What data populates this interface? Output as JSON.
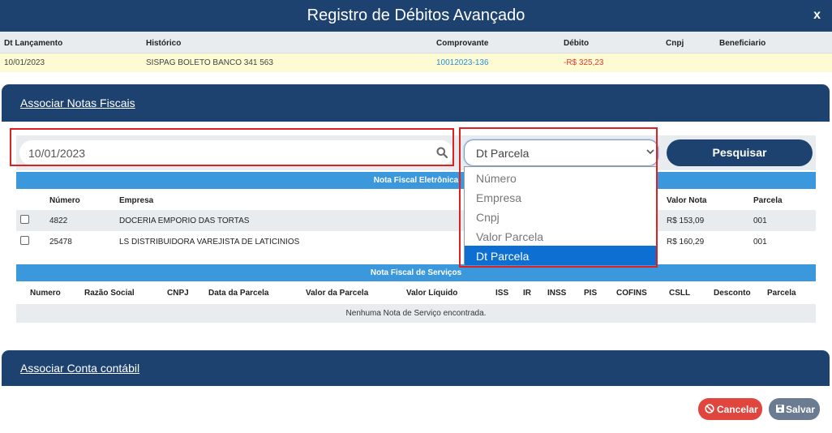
{
  "window": {
    "title": "Registro de Débitos Avançado",
    "close_label": "x"
  },
  "lancamento": {
    "headers": [
      "Dt Lançamento",
      "Histórico",
      "Comprovante",
      "Débito",
      "Cnpj",
      "Beneficiario"
    ],
    "row": {
      "date": "10/01/2023",
      "historico": "SISPAG BOLETO BANCO 341 563",
      "comprovante": "10012023-136",
      "debito": "-R$ 325,23",
      "cnpj": "",
      "beneficiario": ""
    }
  },
  "sections": {
    "notas_title": "Associar Notas Fiscais",
    "conta_title": "Associar Conta contábil"
  },
  "search": {
    "date_value": "10/01/2023",
    "select_value": "Dt Parcela",
    "options": [
      "Número",
      "Empresa",
      "Cnpj",
      "Valor Parcela",
      "Dt Parcela"
    ],
    "button_label": "Pesquisar"
  },
  "nfe": {
    "title": "Nota Fiscal Eletrônica",
    "headers": [
      "Número",
      "Empresa",
      "Valor Nota",
      "Parcela"
    ],
    "rows": [
      {
        "numero": "4822",
        "empresa": "DOCERIA EMPORIO DAS TORTAS",
        "valor": "R$ 153,09",
        "parcela": "001"
      },
      {
        "numero": "25478",
        "empresa": "LS DISTRIBUIDORA VAREJISTA DE LATICINIOS",
        "valor": "R$ 160,29",
        "parcela": "001"
      }
    ]
  },
  "nfs": {
    "title": "Nota Fiscal de Serviços",
    "headers": [
      "Numero",
      "Razão Social",
      "CNPJ",
      "Data da Parcela",
      "Valor da Parcela",
      "Valor Líquido",
      "ISS",
      "IR",
      "INSS",
      "PIS",
      "COFINS",
      "CSLL",
      "Desconto",
      "Parcela"
    ],
    "empty_message": "Nenhuma Nota de Serviço encontrada."
  },
  "footer": {
    "cancel_label": "Cancelar",
    "save_label": "Salvar"
  },
  "colors": {
    "primary": "#1d4270",
    "accent": "#3c98dc",
    "danger": "#e0463e",
    "negative": "#e8382b",
    "highlight_row": "#fdfbd3",
    "selected_option": "#0e6fd2"
  },
  "icons": {
    "search": "search-icon",
    "chevron": "chevron-down-icon",
    "cancel": "ban-icon",
    "save": "floppy-disk-icon",
    "close": "close-icon"
  }
}
